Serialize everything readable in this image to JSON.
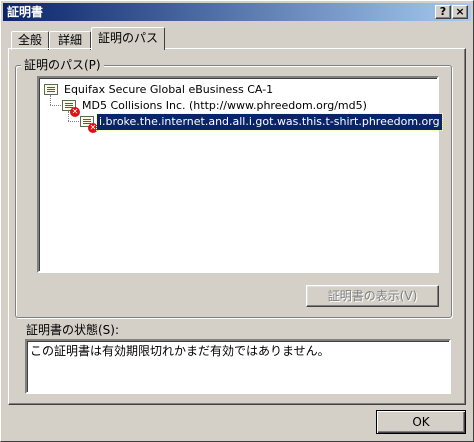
{
  "window": {
    "title": "証明書",
    "help_button": "?",
    "close_button": "×"
  },
  "tabs": [
    {
      "label": "全般",
      "selected": false
    },
    {
      "label": "詳細",
      "selected": false
    },
    {
      "label": "証明のパス",
      "selected": true
    }
  ],
  "cert_path": {
    "group_label": "証明のパス(P)",
    "items": [
      {
        "label": "Equifax Secure Global eBusiness CA-1",
        "icon": "certificate-icon",
        "error": false
      },
      {
        "label": "MD5 Collisions Inc. (http://www.phreedom.org/md5)",
        "icon": "certificate-error-icon",
        "error": true
      },
      {
        "label": "i.broke.the.internet.and.all.i.got.was.this.t-shirt.phreedom.org",
        "icon": "certificate-error-icon",
        "error": true,
        "selected": true
      }
    ],
    "view_button": "証明書の表示(V)",
    "view_button_enabled": false
  },
  "status": {
    "label": "証明書の状態(S):",
    "text": "この証明書は有効期限切れかまだ有効ではありません。"
  },
  "ok_button": "OK",
  "colors": {
    "face": "#d4d0c8",
    "title_start": "#0a246a",
    "title_end": "#a6caf0",
    "selection": "#0a246a",
    "error": "#e01010"
  }
}
